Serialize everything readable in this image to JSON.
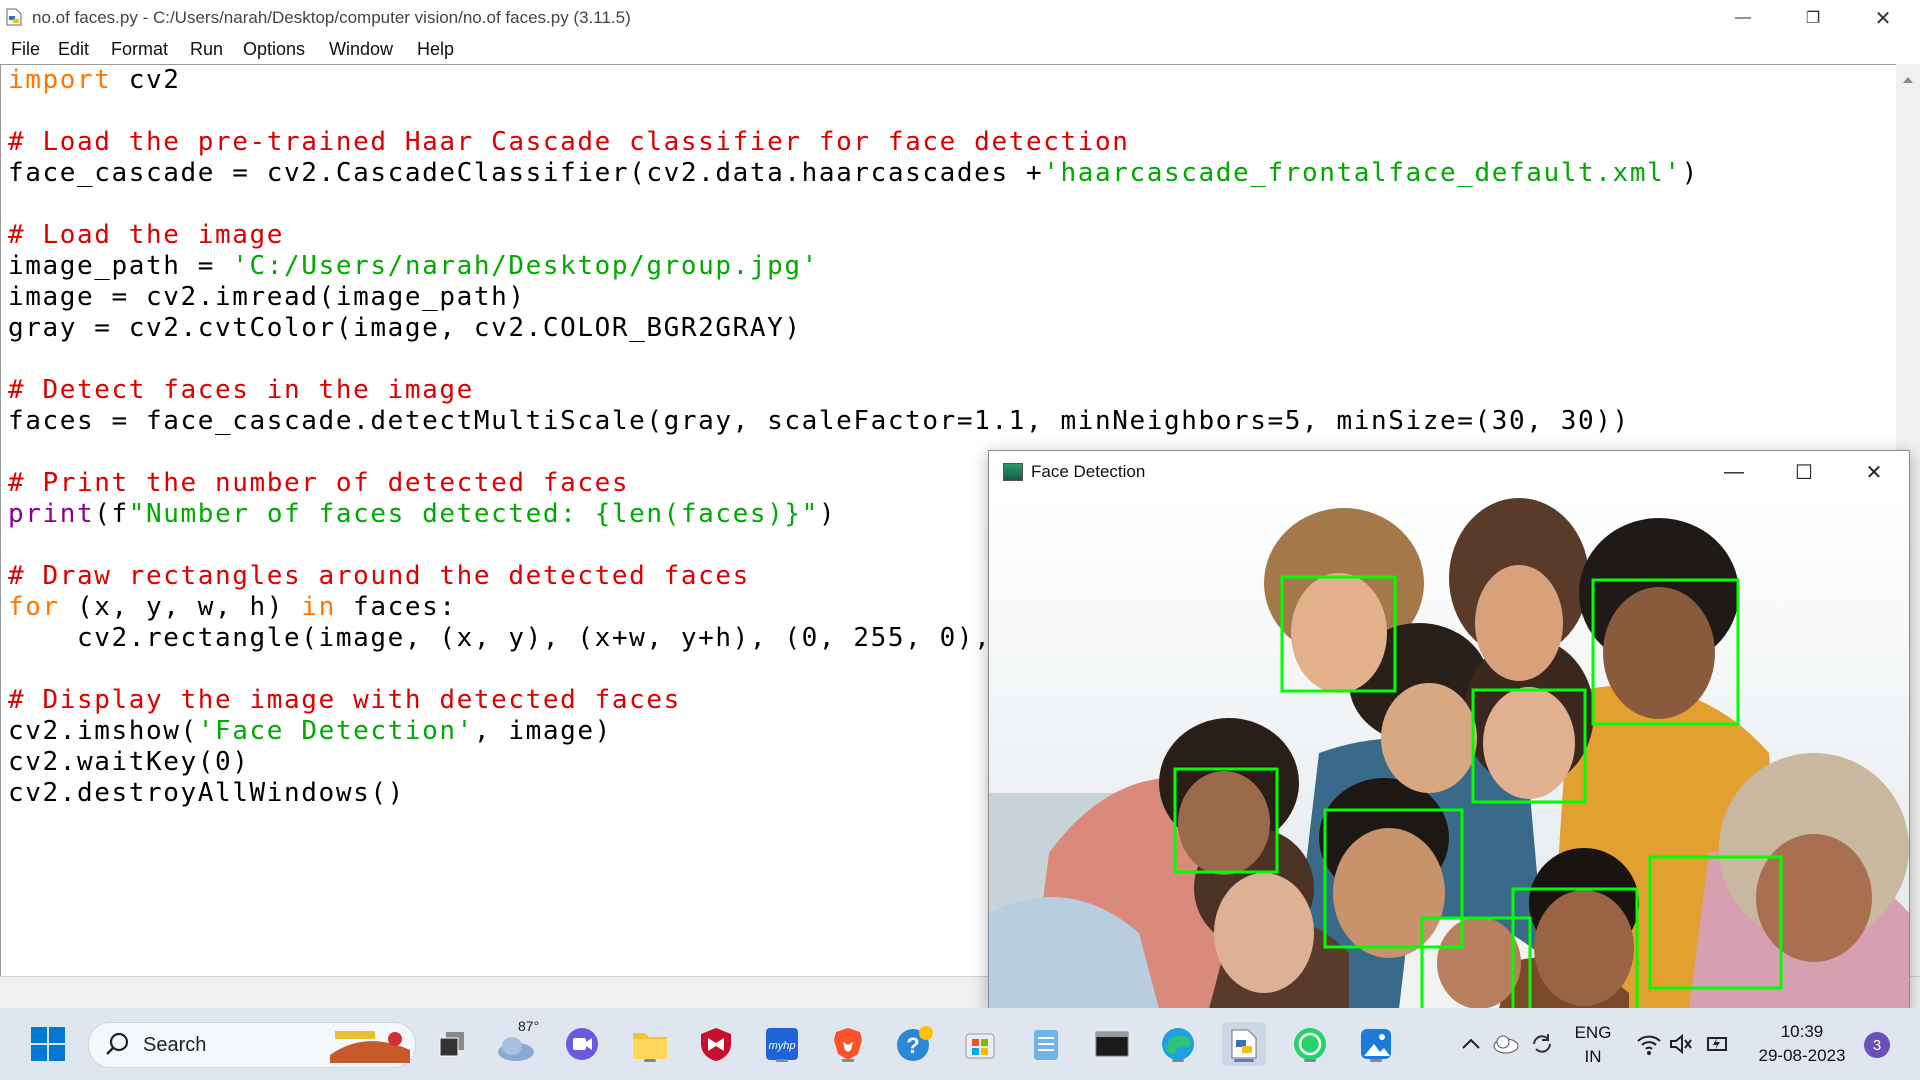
{
  "window": {
    "title": "no.of faces.py - C:/Users/narah/Desktop/computer vision/no.of faces.py (3.11.5)",
    "controls": {
      "minimize": "—",
      "restore": "❐",
      "close": "✕"
    }
  },
  "menu": [
    "File",
    "Edit",
    "Format",
    "Run",
    "Options",
    "Window",
    "Help"
  ],
  "code": {
    "l1_kw": "import",
    "l1_rest": " cv2",
    "l3_cm": "# Load the pre-trained Haar Cascade classifier for face detection",
    "l4_a": "face_cascade = cv2.CascadeClassifier(cv2.data.haarcascades +",
    "l4_st": "'haarcascade_frontalface_default.xml'",
    "l4_b": ")",
    "l6_cm": "# Load the image",
    "l7_a": "image_path = ",
    "l7_st": "'C:/Users/narah/Desktop/group.jpg'",
    "l8": "image = cv2.imread(image_path)",
    "l9": "gray = cv2.cvtColor(image, cv2.COLOR_BGR2GRAY)",
    "l11_cm": "# Detect faces in the image",
    "l12": "faces = face_cascade.detectMultiScale(gray, scaleFactor=1.1, minNeighbors=5, minSize=(30, 30))",
    "l14_cm": "# Print the number of detected faces",
    "l15_bi": "print",
    "l15_a": "(f",
    "l15_st": "\"Number of faces detected: {len(faces)}\"",
    "l15_b": ")",
    "l17_cm": "# Draw rectangles around the detected faces",
    "l18_kw1": "for",
    "l18_a": " (x, y, w, h) ",
    "l18_kw2": "in",
    "l18_b": " faces:",
    "l19": "    cv2.rectangle(image, (x, y), (x+w, y+h), (0, 255, 0),",
    "l21_cm": "# Display the image with detected faces",
    "l22_a": "cv2.imshow(",
    "l22_st": "'Face Detection'",
    "l22_b": ", image)",
    "l23": "cv2.waitKey(0)",
    "l24": "cv2.destroyAllWindows()"
  },
  "face_window": {
    "title": "Face Detection",
    "controls": {
      "minimize": "—",
      "maximize": "☐",
      "close": "✕"
    },
    "detected_faces": 9,
    "box_color": "#00ff00"
  },
  "taskbar": {
    "search_label": "Search",
    "weather_temp": "87°",
    "language_top": "ENG",
    "language_bottom": "IN",
    "time": "10:39",
    "date": "29-08-2023",
    "notification_count": "3",
    "apps": [
      "windows-start",
      "search",
      "widgets",
      "task-view",
      "weather",
      "meet",
      "file-explorer",
      "mcafee",
      "myhp",
      "brave",
      "help",
      "microsoft-store",
      "notepad",
      "terminal",
      "edge",
      "python-idle",
      "whatsapp",
      "photos"
    ]
  }
}
